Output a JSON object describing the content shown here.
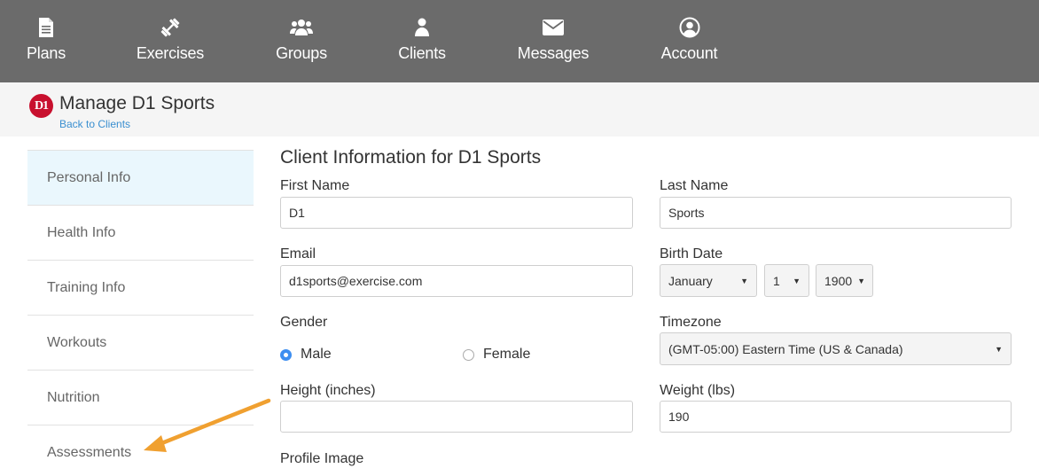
{
  "nav": {
    "items": [
      {
        "label": "Plans",
        "icon": "document-icon"
      },
      {
        "label": "Exercises",
        "icon": "dumbbell-icon"
      },
      {
        "label": "Groups",
        "icon": "users-icon"
      },
      {
        "label": "Clients",
        "icon": "user-icon"
      },
      {
        "label": "Messages",
        "icon": "envelope-icon"
      },
      {
        "label": "Account",
        "icon": "account-circle-icon"
      }
    ]
  },
  "header": {
    "logo_text": "D1",
    "title": "Manage D1 Sports",
    "back_link": "Back to Clients"
  },
  "sidebar": {
    "items": [
      {
        "label": "Personal Info",
        "active": true
      },
      {
        "label": "Health Info"
      },
      {
        "label": "Training Info"
      },
      {
        "label": "Workouts"
      },
      {
        "label": "Nutrition"
      },
      {
        "label": "Assessments"
      }
    ]
  },
  "form": {
    "title": "Client Information for D1 Sports",
    "first_name": {
      "label": "First Name",
      "value": "D1"
    },
    "last_name": {
      "label": "Last Name",
      "value": "Sports"
    },
    "email": {
      "label": "Email",
      "value": "d1sports@exercise.com"
    },
    "birth_date": {
      "label": "Birth Date",
      "month": "January",
      "day": "1",
      "year": "1900"
    },
    "gender": {
      "label": "Gender",
      "options": [
        "Male",
        "Female"
      ],
      "selected": "Male"
    },
    "timezone": {
      "label": "Timezone",
      "value": "(GMT-05:00) Eastern Time (US & Canada)"
    },
    "height": {
      "label": "Height (inches)",
      "value": ""
    },
    "weight": {
      "label": "Weight (lbs)",
      "value": "190"
    },
    "profile_image": {
      "label": "Profile Image"
    }
  },
  "colors": {
    "nav_bg": "#6b6b6b",
    "active_sidebar": "#eaf7fd",
    "link": "#3a8fd0",
    "radio_selected": "#3d8ef0",
    "annotation_arrow": "#f0a030",
    "logo_red": "#c8102e"
  }
}
